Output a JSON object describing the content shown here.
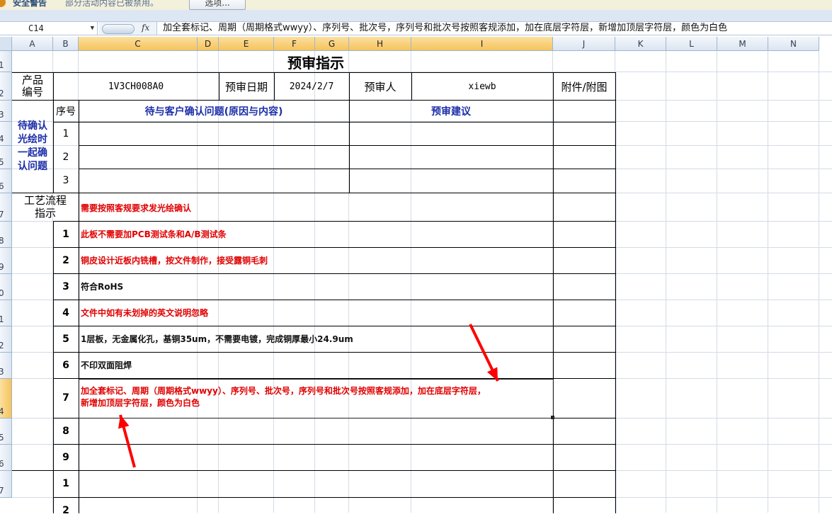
{
  "security_bar": {
    "title": "安全警告",
    "message": "部分活动内容已被禁用。",
    "options_button": "选项..."
  },
  "formula_bar": {
    "name_box": "C14",
    "fx_label": "fx",
    "formula": "加全套标记、周期（周期格式wwyy）、序列号、批次号，序列号和批次号按照客规添加，加在底层字符层，新增加顶层字符层，颜色为白色"
  },
  "columns": [
    "A",
    "B",
    "C",
    "D",
    "E",
    "F",
    "G",
    "H",
    "I",
    "J",
    "K",
    "L",
    "M",
    "N"
  ],
  "rows": [
    "1",
    "2",
    "3",
    "4",
    "5",
    "6",
    "7",
    "8",
    "9",
    "0",
    "1",
    "2",
    "3",
    "4",
    "5",
    "6",
    "7"
  ],
  "sheet": {
    "title": "预审指示",
    "product_label": "产品编号",
    "product_label_l1": "产品",
    "product_label_l2": "编号",
    "product_no": "1V3CH008A0",
    "review_date_label": "预审日期",
    "review_date": "2024/2/7",
    "reviewer_label": "预审人",
    "reviewer": "xiewb",
    "attachment_label": "附件/附图",
    "pending_label_lines": [
      "待确认",
      "光绘时",
      "一起确",
      "认问题"
    ],
    "seq_label": "序号",
    "issue_header": "待与客户确认问题(原因与内容)",
    "suggestion_header": "预审建议",
    "pending_rows": [
      "1",
      "2",
      "3"
    ],
    "process_label_lines": [
      "工艺流程",
      "指示"
    ],
    "process_intro": "需要按照客规要求发光绘确认",
    "process_items": [
      {
        "no": "1",
        "text": "此板不需要加PCB测试条和A/B测试条",
        "color": "#e00000"
      },
      {
        "no": "2",
        "text": "铜皮设计近板内铣槽，按文件制作，接受露铜毛刺",
        "color": "#e00000"
      },
      {
        "no": "3",
        "text": "符合RoHS",
        "color": "#111111"
      },
      {
        "no": "4",
        "text": "文件中如有未划掉的英文说明忽略",
        "color": "#e00000"
      },
      {
        "no": "5",
        "text": "1层板，无金属化孔，基铜35um，不需要电镀，完成铜厚最小24.9um",
        "color": "#111111"
      },
      {
        "no": "6",
        "text": "不印双面阻焊",
        "color": "#111111"
      },
      {
        "no": "7",
        "text_l1": "加全套标记、周期（周期格式wwyy）、序列号、批次号，序列号和批次号按照客规添加，加在底层字符层，",
        "text_l2": "新增加顶层字符层，颜色为白色",
        "color": "#e00000"
      },
      {
        "no": "8",
        "text": "",
        "color": "#111111"
      },
      {
        "no": "9",
        "text": "",
        "color": "#111111"
      }
    ],
    "next_rows": [
      "1",
      "2"
    ]
  },
  "annotations": {
    "arrow_color": "#ff0000"
  }
}
